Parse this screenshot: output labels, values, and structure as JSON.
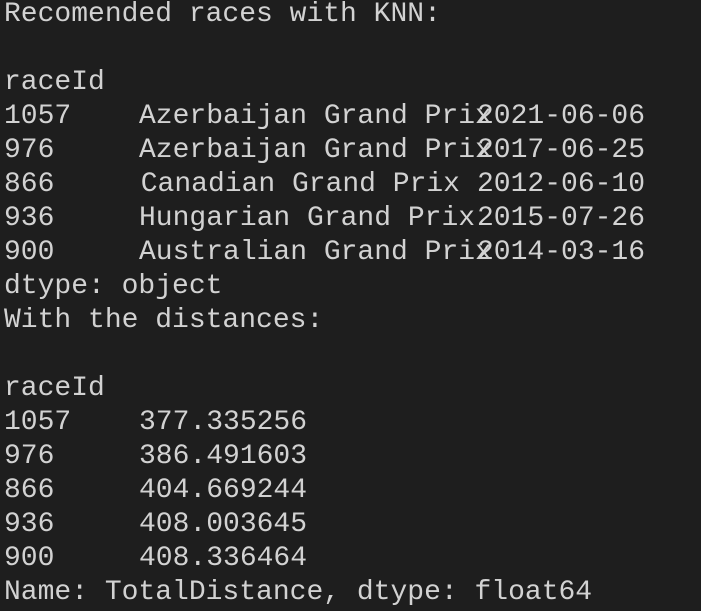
{
  "header": "Recomended races with KNN:",
  "races": {
    "index_name": "raceId",
    "rows": [
      {
        "id": "1057",
        "name": "Azerbaijan Grand Prix",
        "date": "2021-06-06"
      },
      {
        "id": "976",
        "name": "Azerbaijan Grand Prix",
        "date": "2017-06-25"
      },
      {
        "id": "866",
        "name": "Canadian Grand Prix",
        "date": "2012-06-10"
      },
      {
        "id": "936",
        "name": "Hungarian Grand Prix",
        "date": "2015-07-26"
      },
      {
        "id": "900",
        "name": "Australian Grand Prix",
        "date": "2014-03-16"
      }
    ],
    "footer": "dtype: object"
  },
  "distances_header": "With the distances:",
  "distances": {
    "index_name": "raceId",
    "rows": [
      {
        "id": "1057",
        "value": "377.335256"
      },
      {
        "id": "976",
        "value": "386.491603"
      },
      {
        "id": "866",
        "value": "404.669244"
      },
      {
        "id": "936",
        "value": "408.003645"
      },
      {
        "id": "900",
        "value": "408.336464"
      }
    ],
    "footer": "Name: TotalDistance, dtype: float64"
  }
}
